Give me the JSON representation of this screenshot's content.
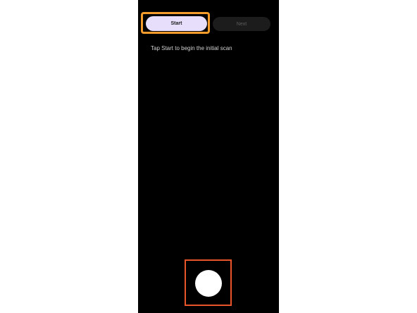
{
  "buttons": {
    "start_label": "Start",
    "next_label": "Next"
  },
  "instruction_text": "Tap Start to begin the initial scan",
  "colors": {
    "screen_background": "#000000",
    "start_button_fill": "#e6defa",
    "next_button_fill": "#1c1c1c",
    "start_highlight": "#f39c2b",
    "capture_highlight": "#e8552b",
    "capture_button_fill": "#ffffff"
  }
}
